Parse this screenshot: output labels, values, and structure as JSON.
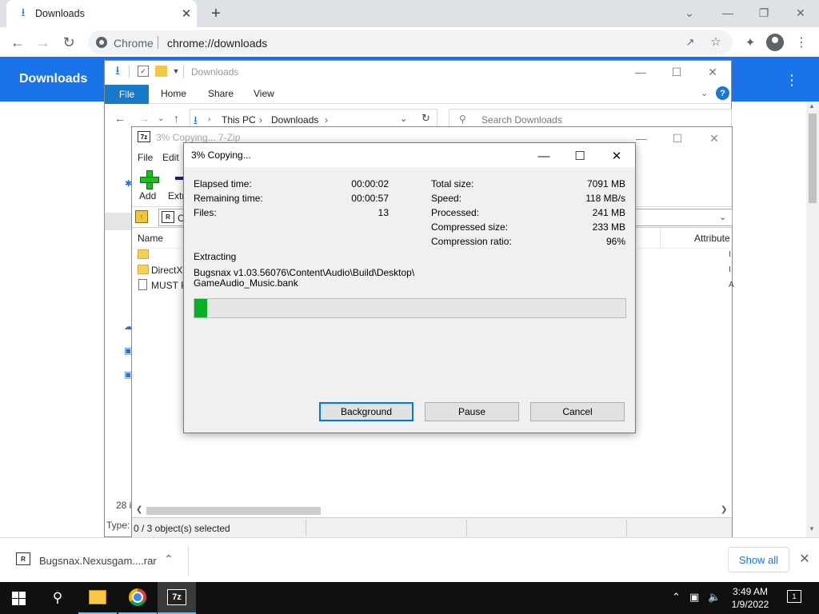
{
  "chrome": {
    "tab_title": "Downloads",
    "omnibox_chip": "Chrome",
    "url": "chrome://downloads",
    "page_title": "Downloads",
    "accent": "#1a73e8"
  },
  "explorer": {
    "title": "Downloads",
    "ribbon": {
      "file": "File",
      "home": "Home",
      "share": "Share",
      "view": "View"
    },
    "breadcrumb": [
      "This PC",
      "Downloads"
    ],
    "search_placeholder": "Search Downloads",
    "item_count": "28 i",
    "status_type": "Type:"
  },
  "sevenzip_fm": {
    "title": "3% Copying... 7-Zip",
    "menu": [
      "File",
      "Edit"
    ],
    "tools": {
      "add": "Add",
      "extract": "Extr"
    },
    "path": "C",
    "columns": {
      "name": "Name",
      "attributes": "Attribute"
    },
    "rows": [
      {
        "name": "",
        "kind": "folder"
      },
      {
        "name": "DirectX",
        "kind": "folder"
      },
      {
        "name": "MUST R",
        "kind": "file"
      }
    ],
    "status": "0 / 3 object(s) selected"
  },
  "progress_dialog": {
    "title": "3% Copying...",
    "left_stats": [
      {
        "label": "Elapsed time:",
        "value": "00:00:02"
      },
      {
        "label": "Remaining time:",
        "value": "00:00:57"
      },
      {
        "label": "Files:",
        "value": "13"
      }
    ],
    "right_stats": [
      {
        "label": "Total size:",
        "value": "7091 MB"
      },
      {
        "label": "Speed:",
        "value": "118 MB/s"
      },
      {
        "label": "Processed:",
        "value": "241 MB"
      },
      {
        "label": "Compressed size:",
        "value": "233 MB"
      },
      {
        "label": "Compression ratio:",
        "value": "96%"
      }
    ],
    "operation": "Extracting",
    "current_path_line1": "Bugsnax v1.03.56076\\Content\\Audio\\Build\\Desktop\\",
    "current_path_line2": "GameAudio_Music.bank",
    "progress_fraction": 0.03,
    "progress_color": "#06b025",
    "buttons": {
      "background": "Background",
      "pause": "Pause",
      "cancel": "Cancel"
    }
  },
  "download_shelf": {
    "file_name": "Bugsnax.Nexusgam....rar",
    "show_all": "Show all"
  },
  "taskbar": {
    "time": "3:49 AM",
    "date": "1/9/2022",
    "notification_count": "1",
    "active_app": "7z"
  }
}
